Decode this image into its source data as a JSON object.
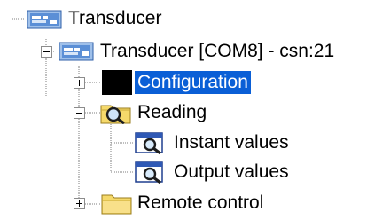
{
  "tree": {
    "nodes": [
      {
        "id": "root",
        "label": "Transducer",
        "icon": "device-icon"
      },
      {
        "id": "port",
        "label": "Transducer [COM8] - csn:21",
        "icon": "device-icon",
        "expander": "minus"
      },
      {
        "id": "configuration",
        "label": "Configuration",
        "icon": "black-square-icon",
        "expander": "plus",
        "selected": true
      },
      {
        "id": "reading",
        "label": "Reading",
        "icon": "search-folder-icon",
        "expander": "minus"
      },
      {
        "id": "instant",
        "label": "Instant values",
        "icon": "view-window-icon"
      },
      {
        "id": "output",
        "label": "Output values",
        "icon": "view-window-icon"
      },
      {
        "id": "remote",
        "label": "Remote control",
        "icon": "folder-icon",
        "expander": "plus"
      }
    ]
  },
  "colors": {
    "selection": "#0a5fd6",
    "selection_text": "#ffffff",
    "folder": "#f5d96b",
    "device_blue": "#5b8fd6"
  }
}
